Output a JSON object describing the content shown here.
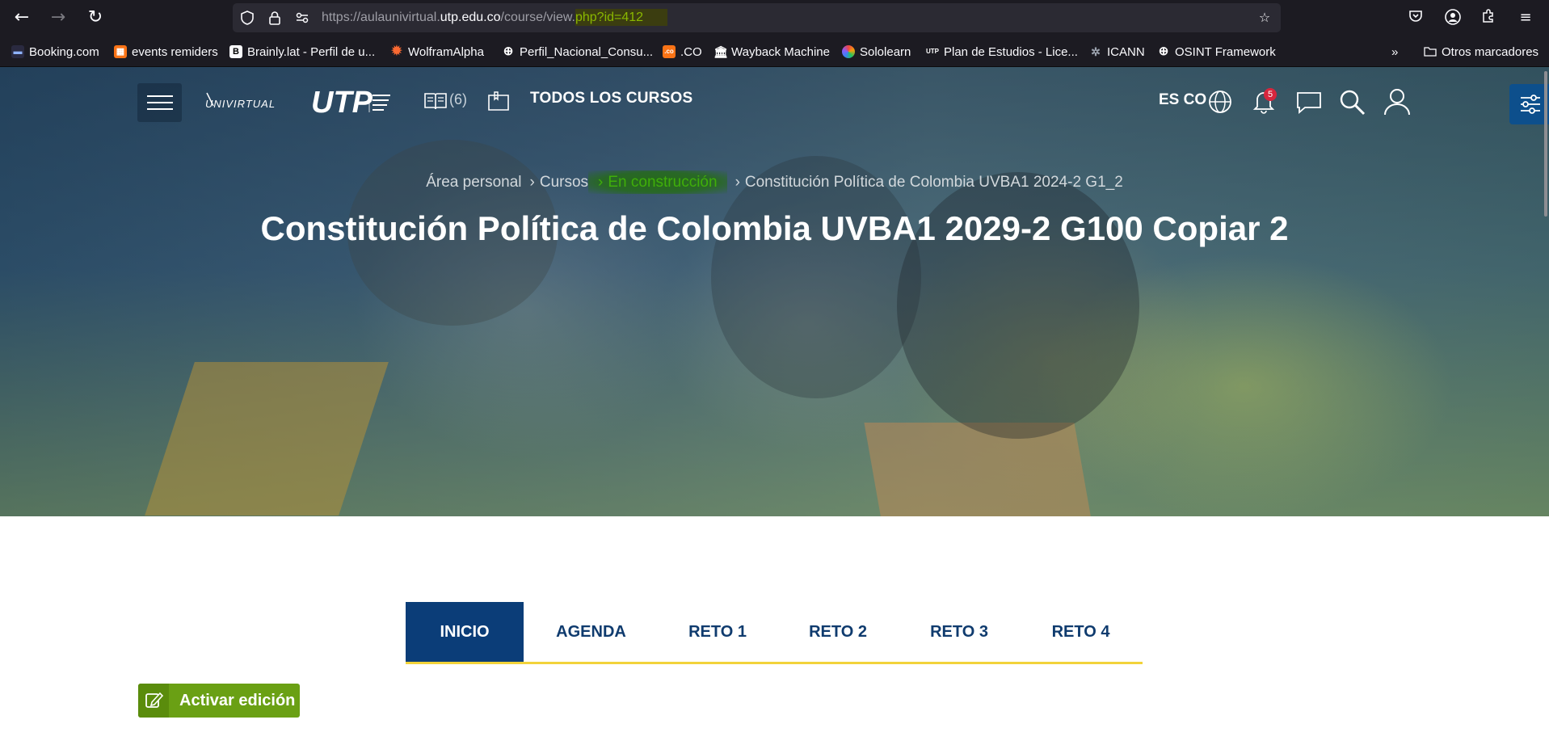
{
  "browser": {
    "url_scheme": "https://",
    "url_host_prefix": "aulaunivirtual.",
    "url_host": "utp.edu.co",
    "url_path": "/course/view.",
    "url_query": "php?id=412"
  },
  "bookmarks": [
    {
      "label": "Booking.com",
      "icon": "booking-icon",
      "color": "#003580"
    },
    {
      "label": "events remiders",
      "icon": "calendar-icon",
      "color": "#f97316"
    },
    {
      "label": "Brainly.lat - Perfil de u...",
      "icon": "brainly-icon",
      "color": "#000000"
    },
    {
      "label": "WolframAlpha",
      "icon": "wolfram-icon",
      "color": "#f96932"
    },
    {
      "label": "Perfil_Nacional_Consu...",
      "icon": "globe-icon",
      "color": "#fbfbfe"
    },
    {
      "label": ".CO",
      "icon": "co-icon",
      "color": "#f97316"
    },
    {
      "label": "Wayback Machine",
      "icon": "wayback-icon",
      "color": "#fbfbfe"
    },
    {
      "label": "Sololearn",
      "icon": "sololearn-icon",
      "color": "#8b5cf6"
    },
    {
      "label": "Plan de Estudios - Lice...",
      "icon": "utp-icon",
      "color": "#fbfbfe"
    },
    {
      "label": "ICANN",
      "icon": "icann-icon",
      "color": "#9ca3af"
    },
    {
      "label": "OSINT Framework",
      "icon": "globe-icon",
      "color": "#fbfbfe"
    }
  ],
  "other_bookmarks": "Otros marcadores",
  "site_nav": {
    "courses_count": "(6)",
    "all_courses": "TODOS LOS CURSOS",
    "language": "ES CO",
    "notifications_count": "5"
  },
  "breadcrumb": {
    "items": [
      "Área personal",
      "Cursos",
      "En construcción",
      "Constitución Política de Colombia UVBA1 2024-2 G1_2"
    ]
  },
  "page_title": "Constitución Política de Colombia UVBA1 2029-2 G100 Copiar 2",
  "tabs": [
    "INICIO",
    "AGENDA",
    "RETO 1",
    "RETO 2",
    "RETO 3",
    "RETO 4"
  ],
  "edit_button": "Activar edición",
  "colors": {
    "primary_blue": "#0b3d78",
    "accent_yellow": "#f2d33a",
    "edit_green": "#6aa014",
    "highlight_green": "#3fae0a"
  }
}
